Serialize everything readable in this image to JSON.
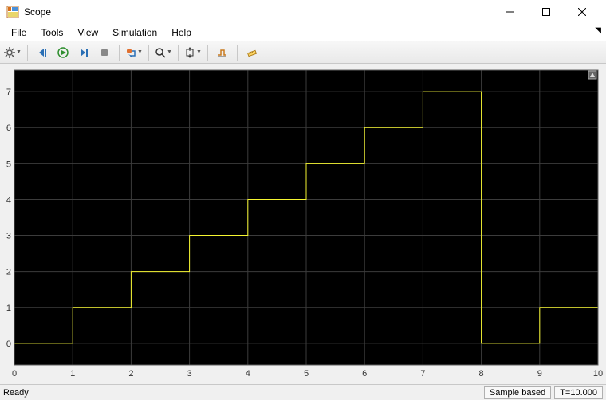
{
  "window": {
    "title": "Scope"
  },
  "menu": {
    "items": [
      "File",
      "Tools",
      "View",
      "Simulation",
      "Help"
    ]
  },
  "toolbar": {
    "buttons": [
      {
        "name": "gear-icon",
        "dropdown": true
      },
      {
        "sep": true
      },
      {
        "name": "step-back-icon"
      },
      {
        "name": "play-icon"
      },
      {
        "name": "step-forward-icon"
      },
      {
        "name": "stop-icon"
      },
      {
        "sep": true
      },
      {
        "name": "highlight-icon",
        "dropdown": true
      },
      {
        "sep": true
      },
      {
        "name": "zoom-icon",
        "dropdown": true
      },
      {
        "sep": true
      },
      {
        "name": "scale-icon",
        "dropdown": true
      },
      {
        "sep": true
      },
      {
        "name": "triggers-icon"
      },
      {
        "sep": true
      },
      {
        "name": "measure-icon"
      }
    ]
  },
  "status": {
    "ready": "Ready",
    "sample": "Sample based",
    "time": "T=10.000"
  },
  "chart_data": {
    "type": "line",
    "step_mode": "post",
    "x": [
      0,
      1,
      2,
      3,
      4,
      5,
      6,
      7,
      8,
      9,
      10
    ],
    "y": [
      0,
      1,
      2,
      3,
      4,
      5,
      6,
      7,
      0,
      1,
      1
    ],
    "xlim": [
      0,
      10
    ],
    "ylim": [
      -0.6,
      7.6
    ],
    "xticks": [
      0,
      1,
      2,
      3,
      4,
      5,
      6,
      7,
      8,
      9,
      10
    ],
    "yticks": [
      0,
      1,
      2,
      3,
      4,
      5,
      6,
      7
    ],
    "line_color": "#f5f531",
    "bg": "#000000",
    "grid": "#3c3c3c",
    "tick_color": "#333333"
  }
}
